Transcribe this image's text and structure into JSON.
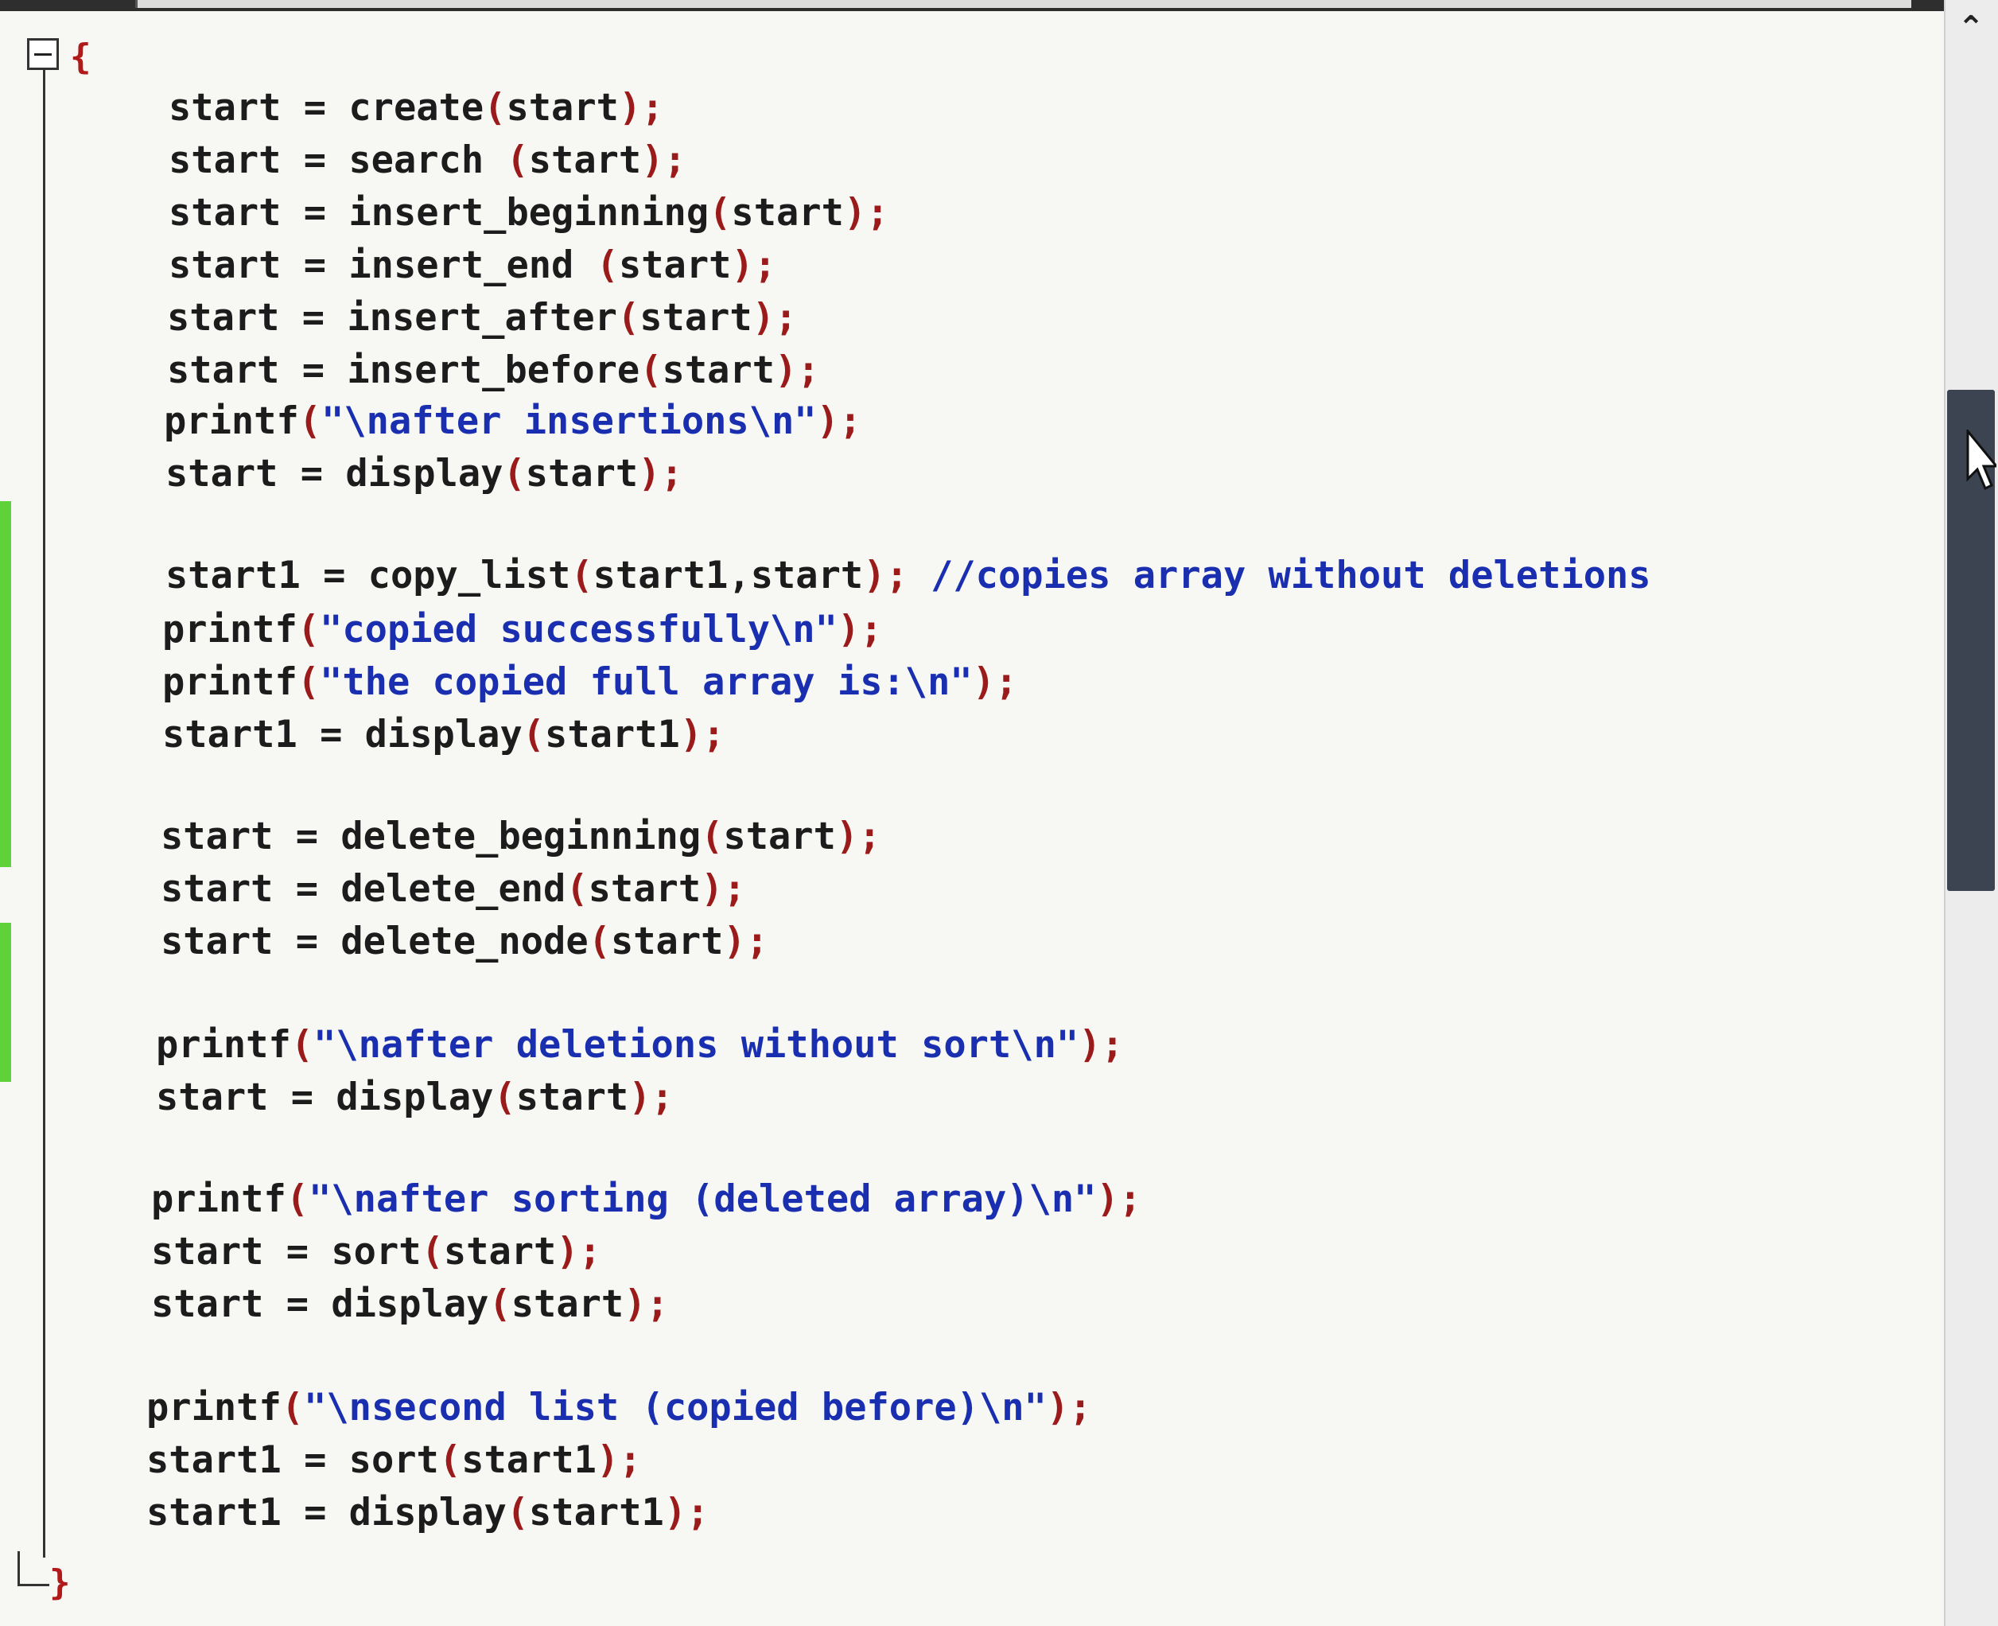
{
  "editor": {
    "open_brace": "{",
    "close_brace": "}",
    "scroll_up_glyph": "⌃",
    "icons": [
      "fold-collapse-icon",
      "scroll-up-icon",
      "mouse-pointer-icon"
    ],
    "colors": {
      "background": "#f7f7f4",
      "keyword_text": "#1c1c1c",
      "string_text": "#1a2fb0",
      "punctuation": "#9b1b1b",
      "change_marker": "#5fd23a",
      "scroll_thumb": "#3b4450"
    }
  },
  "code": {
    "lines": [
      {
        "pre": "start = create",
        "paren": "(",
        "arg": "start",
        "close": ");",
        "str": "",
        "tail": ""
      },
      {
        "pre": "start = search ",
        "paren": "(",
        "arg": "start",
        "close": ");",
        "str": "",
        "tail": ""
      },
      {
        "pre": "start = insert_beginning",
        "paren": "(",
        "arg": "start",
        "close": ");",
        "str": "",
        "tail": ""
      },
      {
        "pre": "start = insert_end ",
        "paren": "(",
        "arg": "start",
        "close": ");",
        "str": "",
        "tail": ""
      },
      {
        "pre": "start = insert_after",
        "paren": "(",
        "arg": "start",
        "close": ");",
        "str": "",
        "tail": ""
      },
      {
        "pre": "start = insert_before",
        "paren": "(",
        "arg": "start",
        "close": ");",
        "str": "",
        "tail": ""
      },
      {
        "pre": "printf",
        "paren": "(",
        "arg": "",
        "close": ");",
        "str": "\"\\nafter insertions\\n\"",
        "tail": ""
      },
      {
        "pre": "start = display",
        "paren": "(",
        "arg": "start",
        "close": ");",
        "str": "",
        "tail": ""
      },
      {
        "pre": "start1 = copy_list",
        "paren": "(",
        "arg": "start1,start",
        "close": ");",
        "str": "",
        "tail": " //copies array without deletions"
      },
      {
        "pre": "printf",
        "paren": "(",
        "arg": "",
        "close": ");",
        "str": "\"copied successfully\\n\"",
        "tail": ""
      },
      {
        "pre": "printf",
        "paren": "(",
        "arg": "",
        "close": ");",
        "str": "\"the copied full array is:\\n\"",
        "tail": ""
      },
      {
        "pre": "start1 = display",
        "paren": "(",
        "arg": "start1",
        "close": ");",
        "str": "",
        "tail": ""
      },
      {
        "pre": "start = delete_beginning",
        "paren": "(",
        "arg": "start",
        "close": ");",
        "str": "",
        "tail": ""
      },
      {
        "pre": "start = delete_end",
        "paren": "(",
        "arg": "start",
        "close": ");",
        "str": "",
        "tail": ""
      },
      {
        "pre": "start = delete_node",
        "paren": "(",
        "arg": "start",
        "close": ");",
        "str": "",
        "tail": ""
      },
      {
        "pre": "printf",
        "paren": "(",
        "arg": "",
        "close": ");",
        "str": "\"\\nafter deletions without sort\\n\"",
        "tail": ""
      },
      {
        "pre": "start = display",
        "paren": "(",
        "arg": "start",
        "close": ");",
        "str": "",
        "tail": ""
      },
      {
        "pre": "printf",
        "paren": "(",
        "arg": "",
        "close": ");",
        "str": "\"\\nafter sorting (deleted array)\\n\"",
        "tail": ""
      },
      {
        "pre": "start = sort",
        "paren": "(",
        "arg": "start",
        "close": ");",
        "str": "",
        "tail": ""
      },
      {
        "pre": "start = display",
        "paren": "(",
        "arg": "start",
        "close": ");",
        "str": "",
        "tail": ""
      },
      {
        "pre": "printf",
        "paren": "(",
        "arg": "",
        "close": ");",
        "str": "\"\\nsecond list (copied before)\\n\"",
        "tail": ""
      },
      {
        "pre": "start1 = sort",
        "paren": "(",
        "arg": "start1",
        "close": ");",
        "str": "",
        "tail": ""
      },
      {
        "pre": "start1 = display",
        "paren": "(",
        "arg": "start1",
        "close": ");",
        "str": "",
        "tail": ""
      }
    ]
  }
}
